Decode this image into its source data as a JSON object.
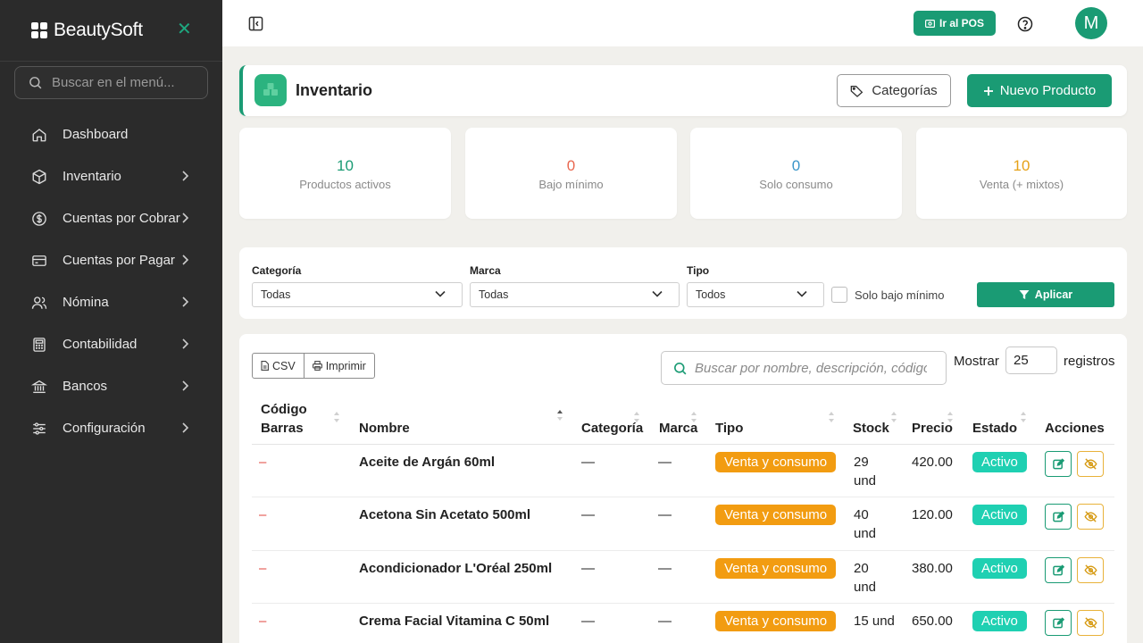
{
  "brand": {
    "name": "BeautySoft"
  },
  "sidebar": {
    "search_placeholder": "Buscar en el menú...",
    "items": [
      {
        "label": "Dashboard",
        "icon": "home-icon"
      },
      {
        "label": "Inventario",
        "icon": "box-icon"
      },
      {
        "label": "Cuentas por Cobrar",
        "icon": "dollar-circle-icon"
      },
      {
        "label": "Cuentas por Pagar",
        "icon": "credit-card-icon"
      },
      {
        "label": "Nómina",
        "icon": "users-icon"
      },
      {
        "label": "Contabilidad",
        "icon": "calculator-icon"
      },
      {
        "label": "Bancos",
        "icon": "bank-icon"
      },
      {
        "label": "Configuración",
        "icon": "sliders-icon"
      }
    ]
  },
  "topbar": {
    "pos_label": "Ir al POS",
    "avatar_initial": "M"
  },
  "page": {
    "title": "Inventario",
    "categories_label": "Categorías",
    "new_product_label": "Nuevo Producto"
  },
  "stats": [
    {
      "value": "10",
      "label": "Productos activos",
      "color": "#1a9b74"
    },
    {
      "value": "0",
      "label": "Bajo mínimo",
      "color": "#e9674f"
    },
    {
      "value": "0",
      "label": "Solo consumo",
      "color": "#3a95c9"
    },
    {
      "value": "10",
      "label": "Venta (+ mixtos)",
      "color": "#e6a117"
    }
  ],
  "filters": {
    "category_label": "Categoría",
    "category_value": "Todas",
    "brand_label": "Marca",
    "brand_value": "Todas",
    "type_label": "Tipo",
    "type_value": "Todos",
    "low_stock_label": "Solo bajo mínimo",
    "apply_label": "Aplicar"
  },
  "table": {
    "csv_label": "CSV",
    "print_label": "Imprimir",
    "search_placeholder": "Buscar por nombre, descripción, código...",
    "show_label": "Mostrar",
    "page_size": "25",
    "records_label": "registros",
    "headers": {
      "barcode_1": "Código",
      "barcode_2": "Barras",
      "name": "Nombre",
      "category": "Categoría",
      "brand": "Marca",
      "type": "Tipo",
      "stock": "Stock",
      "price": "Precio",
      "status": "Estado",
      "actions": "Acciones"
    },
    "rows": [
      {
        "barcode": "–",
        "name": "Aceite de Argán 60ml",
        "category": "—",
        "brand": "—",
        "type": "Venta y consumo",
        "stock_1": "29",
        "stock_2": "und",
        "price": "420.00",
        "status": "Activo"
      },
      {
        "barcode": "–",
        "name": "Acetona Sin Acetato 500ml",
        "category": "—",
        "brand": "—",
        "type": "Venta y consumo",
        "stock_1": "40",
        "stock_2": "und",
        "price": "120.00",
        "status": "Activo"
      },
      {
        "barcode": "–",
        "name": "Acondicionador L'Oréal 250ml",
        "category": "—",
        "brand": "—",
        "type": "Venta y consumo",
        "stock_1": "20",
        "stock_2": "und",
        "price": "380.00",
        "status": "Activo"
      },
      {
        "barcode": "–",
        "name": "Crema Facial Vitamina C 50ml",
        "category": "—",
        "brand": "—",
        "type": "Venta y consumo",
        "stock_1": "15 und",
        "stock_2": "",
        "price": "650.00",
        "status": "Activo"
      }
    ]
  },
  "colors": {
    "accent": "#1a9b74",
    "sidebar_bg": "#2b2b2b",
    "type_badge": "#f29c11",
    "status_badge": "#1fd0b2"
  }
}
